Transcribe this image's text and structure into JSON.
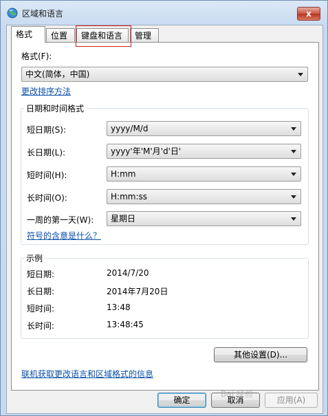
{
  "window": {
    "title": "区域和语言",
    "close_label": "x"
  },
  "tabs": [
    {
      "label": "格式"
    },
    {
      "label": "位置"
    },
    {
      "label": "键盘和语言"
    },
    {
      "label": "管理"
    }
  ],
  "format": {
    "label": "格式(F):",
    "value": "中文(简体，中国)",
    "change_sort_link": "更改排序方法"
  },
  "datetime": {
    "group_title": "日期和时间格式",
    "rows": [
      {
        "label": "短日期(S):",
        "value": "yyyy/M/d"
      },
      {
        "label": "长日期(L):",
        "value": "yyyy'年'M'月'd'日'"
      },
      {
        "label": "短时间(H):",
        "value": "H:mm"
      },
      {
        "label": "长时间(O):",
        "value": "H:mm:ss"
      },
      {
        "label": "一周的第一天(W):",
        "value": "星期日"
      }
    ],
    "notation_link": "符号的含意是什么？"
  },
  "examples": {
    "group_title": "示例",
    "rows": [
      {
        "label": "短日期:",
        "value": "2014/7/20"
      },
      {
        "label": "长日期:",
        "value": "2014年7月20日"
      },
      {
        "label": "短时间:",
        "value": "13:48"
      },
      {
        "label": "长时间:",
        "value": "13:48:45"
      }
    ]
  },
  "other_settings_label": "其他设置(D)...",
  "online_link": "联机获取更改语言和区域格式的信息",
  "buttons": {
    "ok": "确定",
    "cancel": "取消",
    "apply": "应用(A)"
  },
  "watermark": "Bai 经验"
}
